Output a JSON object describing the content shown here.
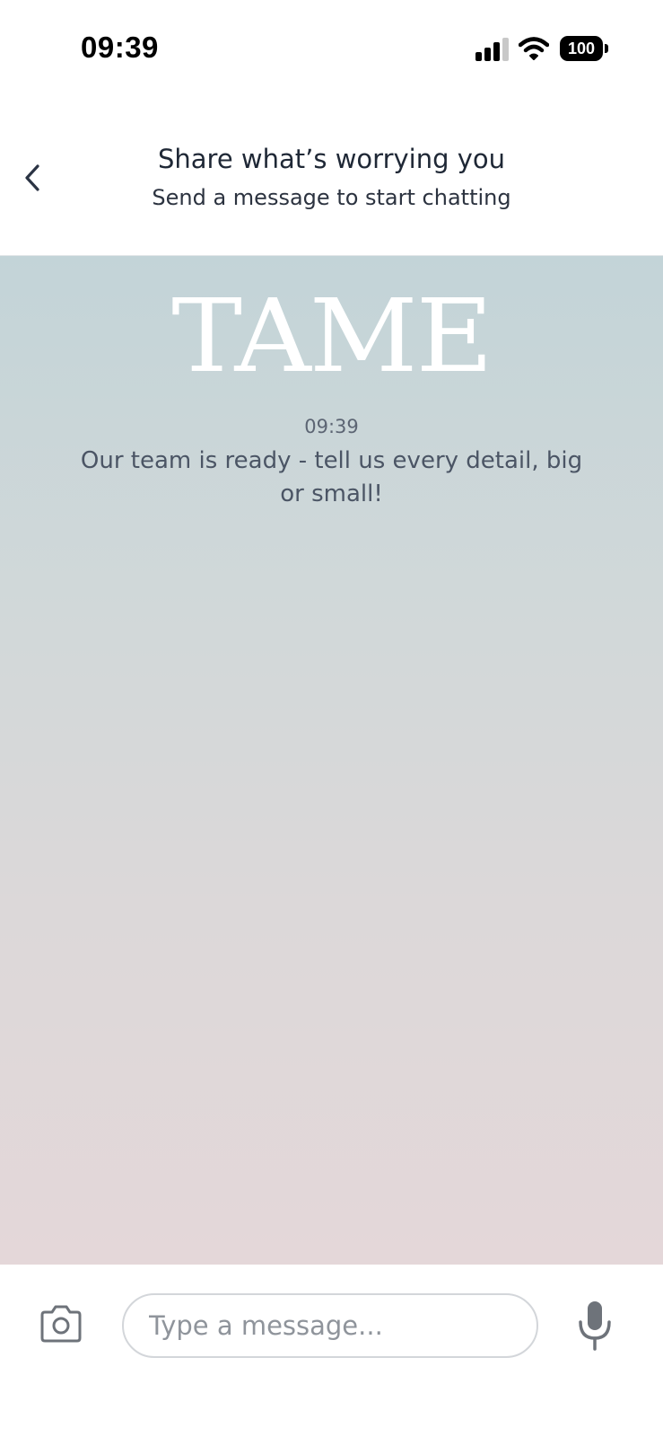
{
  "status_bar": {
    "time": "09:39",
    "battery_level": "100",
    "icons": [
      "signal-icon",
      "wifi-icon",
      "battery-icon"
    ]
  },
  "header": {
    "back_icon": "chevron-left-icon",
    "title": "Share what’s worrying you",
    "subtitle": "Send a message to start chatting"
  },
  "chat": {
    "brand": "TAME",
    "messages": [
      {
        "time": "09:39",
        "text": "Our team is ready - tell us every detail, big or small!"
      }
    ]
  },
  "composer": {
    "camera_icon": "camera-icon",
    "input_placeholder": "Type a message...",
    "input_value": "",
    "mic_icon": "microphone-icon"
  },
  "colors": {
    "title_text": "#1f2836",
    "chat_gradient_top": "#c3d4d8",
    "chat_gradient_bottom": "#e4d7d9",
    "message_text": "#4b5565"
  }
}
